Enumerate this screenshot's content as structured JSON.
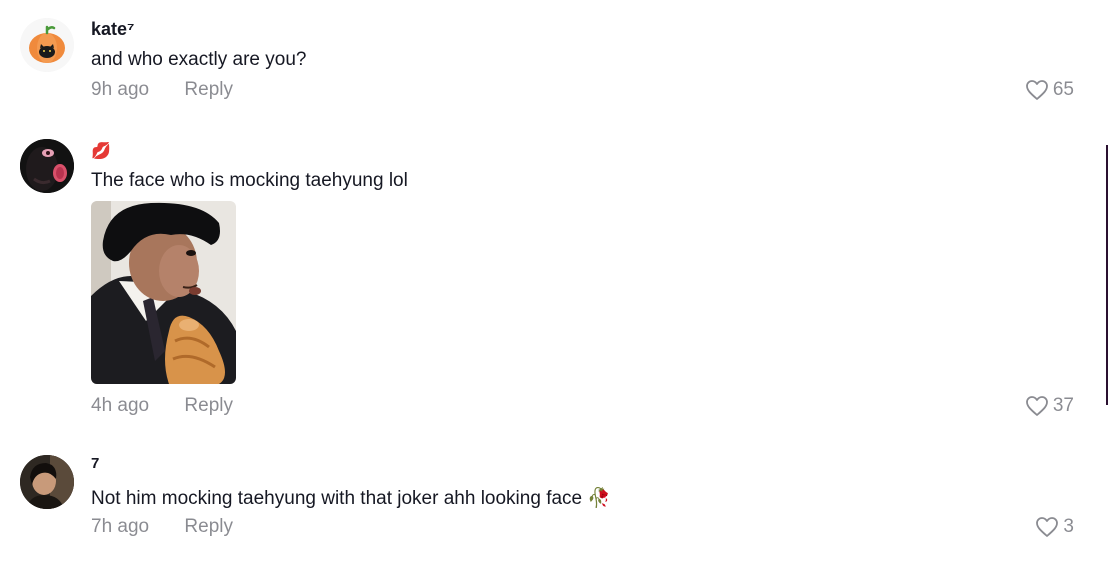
{
  "comments": [
    {
      "username": "kate⁷",
      "avatar_icon": "pumpkin-cat-icon",
      "text": "and who exactly are you?",
      "time": "9h ago",
      "reply_label": "Reply",
      "likes": "65"
    },
    {
      "username": "💋",
      "avatar_icon": "dark-face-avatar",
      "text": "The face who is mocking taehyung lol",
      "image": "person-in-suit-holding-bread-photo",
      "time": "4h ago",
      "reply_label": "Reply",
      "likes": "37"
    },
    {
      "username": "7",
      "avatar_icon": "person-photo-avatar",
      "text": "Not him mocking taehyung with that joker ahh looking face 🥀",
      "time": "7h ago",
      "reply_label": "Reply",
      "likes": "3"
    }
  ],
  "colors": {
    "primary_text": "#161823",
    "secondary_text": "#8a8b91",
    "background": "#ffffff"
  }
}
